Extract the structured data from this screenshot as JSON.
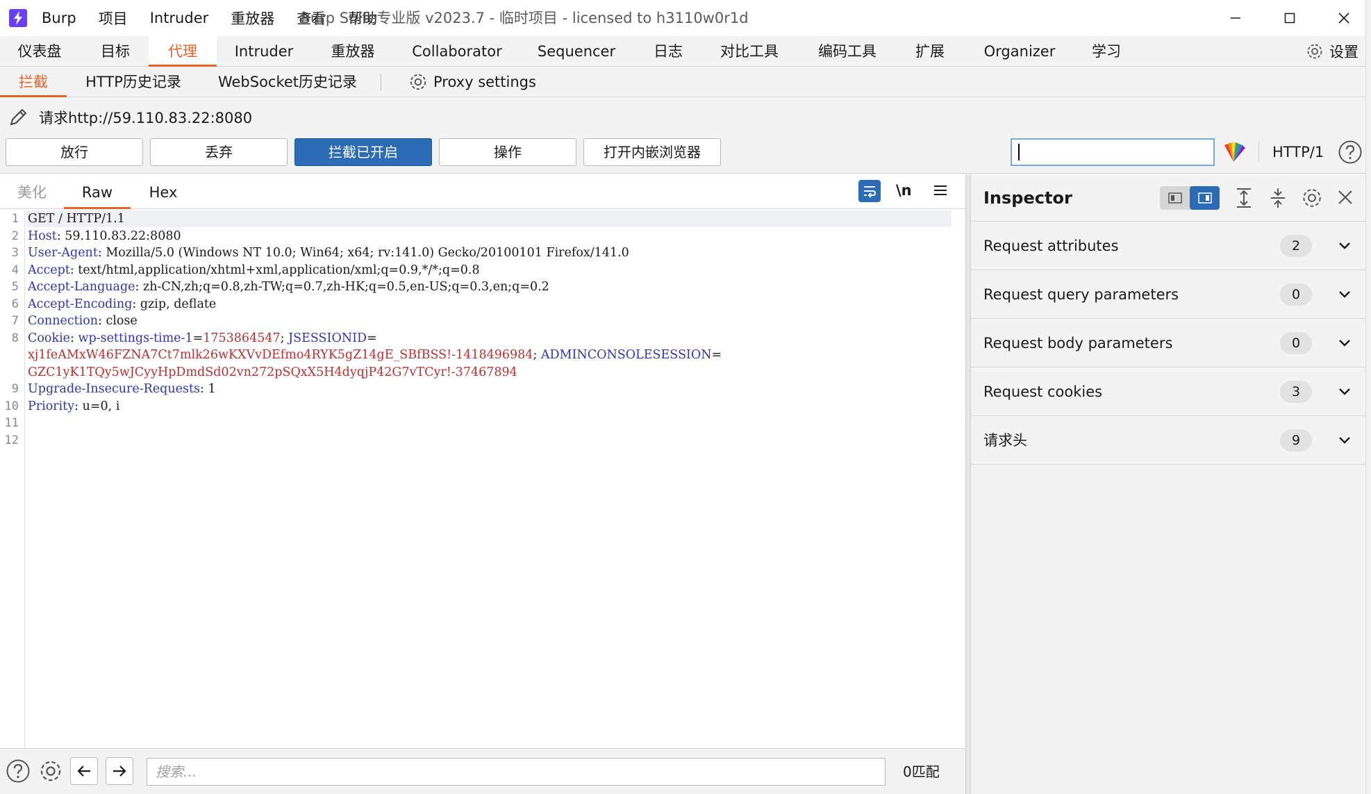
{
  "app": {
    "window_title": "Burp Suite专业版  v2023.7 - 临时项目 - licensed to h3110w0r1d",
    "menu": [
      "Burp",
      "项目",
      "Intruder",
      "重放器",
      "查看",
      "帮助"
    ]
  },
  "main_tabs": [
    "仪表盘",
    "目标",
    "代理",
    "Intruder",
    "重放器",
    "Collaborator",
    "Sequencer",
    "日志",
    "对比工具",
    "编码工具",
    "扩展",
    "Organizer",
    "学习"
  ],
  "main_tabs_active": "代理",
  "settings_label": "设置",
  "sub_tabs": [
    "拦截",
    "HTTP历史记录",
    "WebSocket历史记录"
  ],
  "sub_tabs_active": "拦截",
  "proxy_settings_label": "Proxy settings",
  "request": {
    "url_label": "请求http://59.110.83.22:8080",
    "buttons": [
      "放行",
      "丢弃",
      "拦截已开启",
      "操作",
      "打开内嵌浏览器"
    ],
    "search_value": "",
    "http_version": "HTTP/1"
  },
  "editor": {
    "tabs": [
      "美化",
      "Raw",
      "Hex"
    ],
    "active_tab": "Raw",
    "newline_label": "\\n",
    "line_numbers": [
      "1",
      "2",
      "3",
      "4",
      "5",
      "6",
      "7",
      "8",
      "9",
      "10",
      "11",
      "12"
    ],
    "lines": {
      "l1": "GET / HTTP/1.1",
      "l2_key": "Host",
      "l2_val": ": 59.110.83.22:8080",
      "l3_key": "User-Agent",
      "l3_val": ": Mozilla/5.0 (Windows NT 10.0; Win64; x64; rv:141.0) Gecko/20100101 Firefox/141.0",
      "l4_key": "Accept",
      "l4_val": ": text/html,application/xhtml+xml,application/xml;q=0.9,*/*;q=0.8",
      "l5_key": "Accept-Language",
      "l5_val": ": zh-CN,zh;q=0.8,zh-TW;q=0.7,zh-HK;q=0.5,en-US;q=0.3,en;q=0.2",
      "l6_key": "Accept-Encoding",
      "l6_val": ": gzip, deflate",
      "l7_key": "Connection",
      "l7_val": ": close",
      "l8_key": "Cookie",
      "l8_sep": ": ",
      "l8_c1_name": "wp-settings-time-1",
      "l8_c1_eq": "=",
      "l8_c1_val": "1753864547",
      "l8_semi": "; ",
      "l8_c2_name": "JSESSIONID",
      "l8_c2_eq": "=",
      "l8b_c2_val": "xj1feAMxW46FZNA7Ct7mlk26wKXVvDEfmo4RYK5gZ14gE_SBfBSS!-1418496984",
      "l8b_semi": "; ",
      "l8b_c3_name": "ADMINCONSOLESESSION",
      "l8b_c3_eq": "=",
      "l8c_c3_val": "GZC1yK1TQy5wJCyyHpDmdSd02vn272pSQxX5H4dyqjP42G7vTCyr!-37467894",
      "l9_key": "Upgrade-Insecure-Requests",
      "l9_val": ": 1",
      "l10_key": "Priority",
      "l10_val": ": u=0, i"
    },
    "search_placeholder": "搜索...",
    "match_count": "0匹配"
  },
  "inspector": {
    "title": "Inspector",
    "sections": [
      {
        "label": "Request attributes",
        "count": "2"
      },
      {
        "label": "Request query parameters",
        "count": "0"
      },
      {
        "label": "Request body parameters",
        "count": "0"
      },
      {
        "label": "Request cookies",
        "count": "3"
      },
      {
        "label": "请求头",
        "count": "9"
      }
    ]
  },
  "colors": {
    "accent_orange": "#e8632a",
    "intercept_on_blue": "#2c6cb6",
    "header_key_blue": "#3134b8",
    "cookie_value_red": "#c02e2e",
    "logo_purple": "#6a3ff5"
  }
}
